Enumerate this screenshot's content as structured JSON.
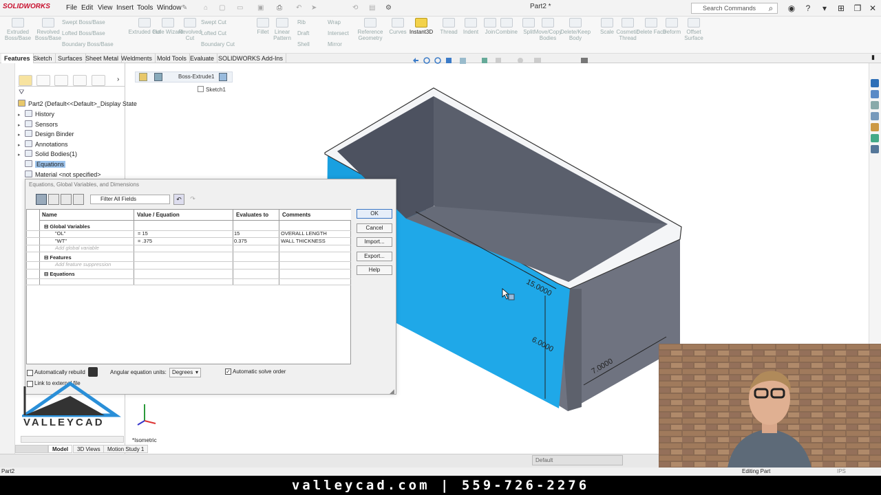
{
  "app": {
    "logo_text": "SOLIDWORKS",
    "menus": [
      "File",
      "Edit",
      "View",
      "Insert",
      "Tools",
      "Window"
    ],
    "doc_title": "Part2 *",
    "search_placeholder": "Search Commands"
  },
  "command_manager": {
    "tools": [
      {
        "label": "Extruded Boss/Base",
        "icon": "extrude-icon",
        "enabled": false
      },
      {
        "label": "Revolved Boss/Base",
        "icon": "revolve-icon",
        "enabled": false
      },
      {
        "label": "Extruded Cut",
        "icon": "extruded-cut-icon",
        "enabled": false
      },
      {
        "label": "Hole Wizard",
        "icon": "hole-wizard-icon",
        "enabled": false
      },
      {
        "label": "Revolved Cut",
        "icon": "revolved-cut-icon",
        "enabled": false
      },
      {
        "label": "Fillet",
        "icon": "fillet-icon",
        "enabled": false
      },
      {
        "label": "Linear Pattern",
        "icon": "linear-pattern-icon",
        "enabled": false
      },
      {
        "label": "Reference Geometry",
        "icon": "reference-geometry-icon",
        "enabled": false
      },
      {
        "label": "Curves",
        "icon": "curves-icon",
        "enabled": false
      },
      {
        "label": "Instant3D",
        "icon": "instant3d-icon",
        "enabled": true
      },
      {
        "label": "Thread",
        "icon": "thread-icon",
        "enabled": false
      },
      {
        "label": "Indent",
        "icon": "indent-icon",
        "enabled": false
      },
      {
        "label": "Join",
        "icon": "join-icon",
        "enabled": false
      },
      {
        "label": "Combine",
        "icon": "combine-icon",
        "enabled": false
      },
      {
        "label": "Split",
        "icon": "split-icon",
        "enabled": false
      },
      {
        "label": "Move/Copy Bodies",
        "icon": "move-copy-icon",
        "enabled": false
      },
      {
        "label": "Delete/Keep Body",
        "icon": "delete-keep-icon",
        "enabled": false
      },
      {
        "label": "Scale",
        "icon": "scale-icon",
        "enabled": false
      },
      {
        "label": "Cosmetic Thread",
        "icon": "cosmetic-thread-icon",
        "enabled": false
      },
      {
        "label": "Delete Face",
        "icon": "delete-face-icon",
        "enabled": false
      },
      {
        "label": "Deform",
        "icon": "deform-icon",
        "enabled": false
      },
      {
        "label": "Offset Surface",
        "icon": "offset-surface-icon",
        "enabled": false
      }
    ],
    "small_tools": [
      "Swept Boss/Base",
      "Lofted Boss/Base",
      "Boundary Boss/Base",
      "Swept Cut",
      "Lofted Cut",
      "Boundary Cut",
      "Rib",
      "Wrap",
      "Draft",
      "Intersect",
      "Shell",
      "Mirror"
    ]
  },
  "tabs": [
    "Features",
    "Sketch",
    "Surfaces",
    "Sheet Metal",
    "Weldments",
    "Mold Tools",
    "Evaluate",
    "SOLIDWORKS Add-Ins"
  ],
  "feature_tree": {
    "root": "Part2  (Default<<Default>_Display State",
    "items": [
      "History",
      "Sensors",
      "Design Binder",
      "Annotations",
      "Solid Bodies(1)",
      "Equations",
      "Material <not specified>"
    ]
  },
  "breadcrumb": {
    "feature": "Boss-Extrude1",
    "sketch": "Sketch1"
  },
  "dialog": {
    "title": "Equations, Global Variables, and Dimensions",
    "filter_label": "Filter All Fields",
    "columns": [
      "Name",
      "Value / Equation",
      "Evaluates to",
      "Comments"
    ],
    "sections": {
      "global": "Global Variables",
      "features": "Features",
      "equations": "Equations"
    },
    "variables": [
      {
        "name": "\"OL\"",
        "value": "= 15",
        "evaluates": "15",
        "comment": "OVERALL LENGTH"
      },
      {
        "name": "\"WT\"",
        "value": "= .375",
        "evaluates": "0.375",
        "comment": "WALL THICKNESS"
      }
    ],
    "add_global_placeholder": "Add global variable",
    "add_feature_placeholder": "Add feature suppression",
    "buttons": {
      "ok": "OK",
      "cancel": "Cancel",
      "import": "Import...",
      "export": "Export...",
      "help": "Help"
    },
    "auto_rebuild_label": "Automatically rebuild",
    "link_label": "Link to external file",
    "angle_units_label": "Angular equation units:",
    "angle_units_value": "Degrees",
    "auto_solve_label": "Automatic solve order"
  },
  "viewport": {
    "dimensions": [
      "15.0000",
      "6.0000",
      "7.0000"
    ],
    "view_label": "*Isometric"
  },
  "bottom_tabs": [
    "Model",
    "3D Views",
    "Motion Study 1"
  ],
  "config_select": "Default",
  "status": {
    "left": "Part2",
    "mode": "Editing Part",
    "units": "IPS"
  },
  "branding": {
    "logo_text": "VALLEYCAD",
    "footer": "valleycad.com | 559-726-2276"
  },
  "colors": {
    "selected_face": "#1fa8e8",
    "accent": "#c8102e",
    "selection": "#9ec5ee"
  }
}
